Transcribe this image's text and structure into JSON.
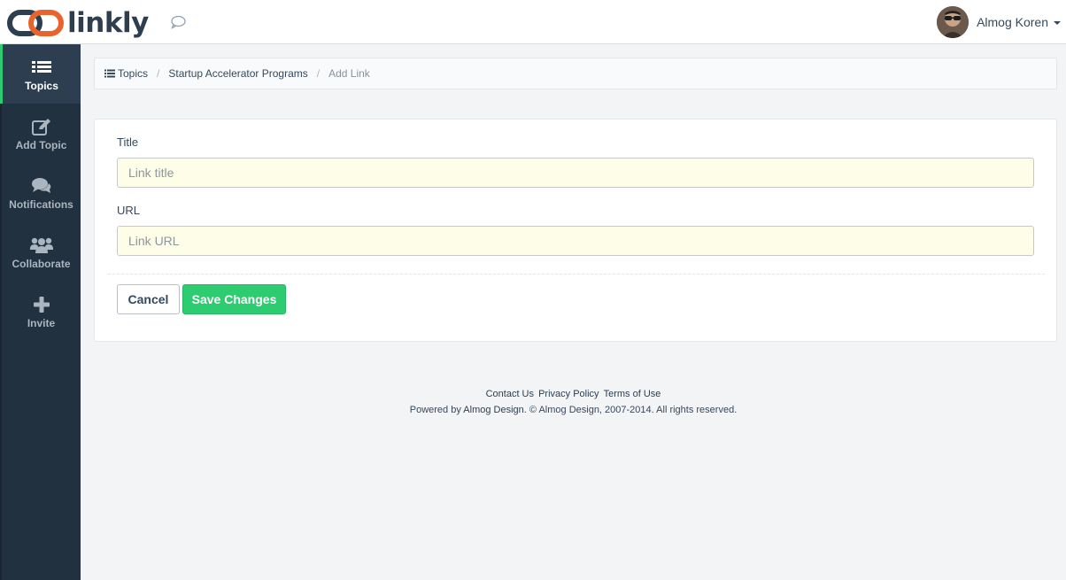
{
  "brand": {
    "name": "linkly",
    "colors": {
      "orange": "#e8642c",
      "navy": "#2c3e50",
      "green": "#2ecc71"
    }
  },
  "header": {
    "chat_icon": "speech-bubble-icon",
    "user": {
      "name": "Almog Koren"
    }
  },
  "sidebar": {
    "items": [
      {
        "label": "Topics",
        "icon": "list-icon",
        "active": true
      },
      {
        "label": "Add Topic",
        "icon": "edit-icon",
        "active": false
      },
      {
        "label": "Notifications",
        "icon": "comments-icon",
        "active": false
      },
      {
        "label": "Collaborate",
        "icon": "group-icon",
        "active": false
      },
      {
        "label": "Invite",
        "icon": "plus-icon",
        "active": false
      }
    ]
  },
  "breadcrumb": {
    "items": [
      "Topics",
      "Startup Accelerator Programs"
    ],
    "current": "Add Link"
  },
  "form": {
    "title_label": "Title",
    "title_placeholder": "Link title",
    "title_value": "",
    "url_label": "URL",
    "url_placeholder": "Link URL",
    "url_value": "",
    "cancel_label": "Cancel",
    "save_label": "Save Changes"
  },
  "footer": {
    "links": [
      "Contact Us",
      "Privacy Policy",
      "Terms of Use"
    ],
    "powered_prefix": "Powered by",
    "powered_link": "Almog Design.",
    "copyright": "© Almog Design, 2007-2014. All rights reserved."
  }
}
